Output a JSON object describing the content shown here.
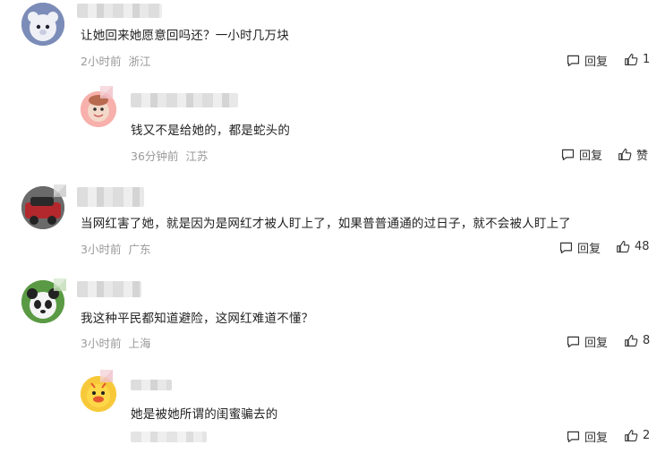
{
  "comments": [
    {
      "text": "让她回来她愿意回吗还？一小时几万块",
      "time": "2小时前",
      "location": "浙江",
      "reply": "回复",
      "likes": "1"
    },
    {
      "text": "钱又不是给她的，都是蛇头的",
      "time": "36分钟前",
      "location": "江苏",
      "reply": "回复",
      "likes": "赞"
    },
    {
      "text": "当网红害了她，就是因为是网红才被人盯上了，如果普普通通的过日子，就不会被人盯上了",
      "time": "3小时前",
      "location": "广东",
      "reply": "回复",
      "likes": "48"
    },
    {
      "text": "我这种平民都知道避险，这网红难道不懂？",
      "time": "3小时前",
      "location": "上海",
      "reply": "回复",
      "likes": "8"
    },
    {
      "text": "她是被她所谓的闺蜜骗去的",
      "reply": "回复",
      "likes": "2"
    }
  ],
  "icons": {
    "reply": "comment-bubble-icon",
    "like": "thumbs-up-icon"
  },
  "colors": {
    "meta": "#999999",
    "text": "#222222"
  }
}
